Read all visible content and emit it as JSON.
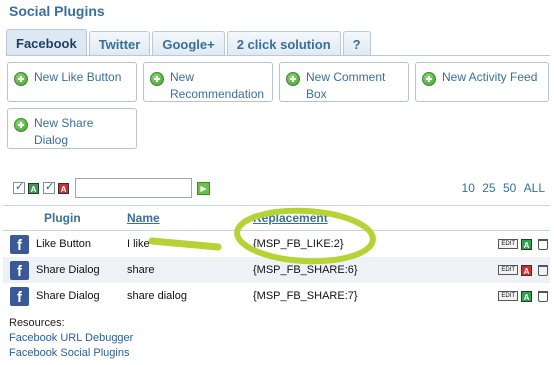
{
  "title": "Social Plugins",
  "tabs": [
    "Facebook",
    "Twitter",
    "Google+",
    "2 click solution",
    "?"
  ],
  "buttons": [
    "New Like Button",
    "New Recommendation",
    "New Comment Box",
    "New Activity Feed",
    "New Share Dialog"
  ],
  "filter": {
    "tag_a": "A",
    "tag_i": "A",
    "search_value": ""
  },
  "paging": [
    "10",
    "25",
    "50",
    "ALL"
  ],
  "table": {
    "headers": {
      "plugin": "Plugin",
      "name": "Name",
      "replacement": "Replacement"
    },
    "rows": [
      {
        "plugin": "Like Button",
        "name": "I like",
        "replacement": "{MSP_FB_LIKE:2}",
        "status": "A"
      },
      {
        "plugin": "Share Dialog",
        "name": "share",
        "replacement": "{MSP_FB_SHARE:6}",
        "status": "A"
      },
      {
        "plugin": "Share Dialog",
        "name": "share dialog",
        "replacement": "{MSP_FB_SHARE:7}",
        "status": "A"
      }
    ],
    "edit_label": "EDIT"
  },
  "resources": {
    "label": "Resources:",
    "links": [
      "Facebook URL Debugger",
      "Facebook Social Plugins"
    ]
  },
  "colors": {
    "accent": "#3a6f9a",
    "highlighter": "#b5d334",
    "active": "#2ea34a",
    "inactive": "#d62c2c"
  }
}
